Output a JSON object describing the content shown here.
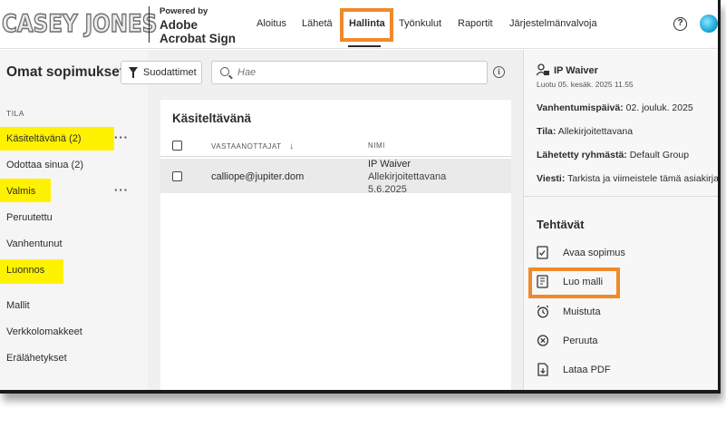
{
  "header": {
    "logo_text": "CASEY JONES",
    "brand_powered": "Powered by",
    "brand_line1": "Adobe",
    "brand_line2": "Acrobat Sign",
    "nav": [
      "Aloitus",
      "Lähetä",
      "Hallinta",
      "Työnkulut",
      "Raportit",
      "Järjestelmänvalvoja"
    ],
    "help_icon_glyph": "?"
  },
  "toolbar": {
    "title": "Omat sopimukset",
    "filter_label": "Suodattimet",
    "search_placeholder": "Hae",
    "info_glyph": "i"
  },
  "sidebar": {
    "section_label": "TILA",
    "items": [
      "Käsiteltävänä (2)",
      "Odottaa sinua (2)",
      "Valmis",
      "Peruutettu",
      "Vanhentunut",
      "Luonnos",
      "Mallit",
      "Verkkolomakkeet",
      "Erälähetykset"
    ],
    "more_glyph": "···"
  },
  "list": {
    "title": "Käsiteltävänä",
    "col_recipients": "VASTAANOTTAJAT",
    "sort_glyph": "↓",
    "col_name": "NIMI",
    "rows": [
      {
        "recipient": "calliope@jupiter.dom",
        "name": "IP Waiver",
        "status": "Allekirjoitettavana",
        "date": "5.6.2025"
      }
    ]
  },
  "detail": {
    "title": "IP Waiver",
    "created": "Luotu 05. kesäk. 2025 11.55",
    "expiry_label": "Vanhentumispäivä:",
    "expiry_value": "02. jouluk. 2025",
    "status_label": "Tila:",
    "status_value": "Allekirjoitettavana",
    "group_label": "Lähetetty ryhmästä:",
    "group_value": "Default Group",
    "message_label": "Viesti:",
    "message_value": "Tarkista ja viimeistele tämä asiakirja.",
    "tasks_title": "Tehtävät",
    "tasks": [
      "Avaa sopimus",
      "Luo malli",
      "Muistuta",
      "Peruuta",
      "Lataa PDF"
    ]
  },
  "colors": {
    "highlight_orange": "#ef8a2a",
    "highlight_yellow": "#fff200",
    "text": "#2c2c2c"
  }
}
